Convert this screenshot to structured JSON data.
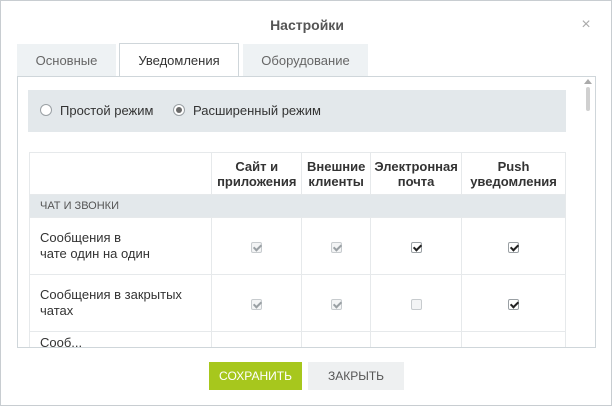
{
  "dialog": {
    "title": "Настройки",
    "close_glyph": "×"
  },
  "tabs": [
    {
      "label": "Основные",
      "active": false
    },
    {
      "label": "Уведомления",
      "active": true
    },
    {
      "label": "Оборудование",
      "active": false
    }
  ],
  "mode": {
    "simple_label": "Простой режим",
    "extended_label": "Расширенный режим",
    "selected": "extended"
  },
  "table": {
    "headers": {
      "col1": [
        "Сайт и",
        "приложения"
      ],
      "col2": [
        "Внешние",
        "клиенты"
      ],
      "col3": [
        "Электронная",
        "почта"
      ],
      "col4": [
        "Push",
        "уведомления"
      ]
    },
    "section": "ЧАТ И ЗВОНКИ",
    "rows": [
      {
        "label": [
          "Сообщения в",
          "чате один на один"
        ],
        "site": true,
        "external": true,
        "email": true,
        "push": true,
        "site_disabled": true,
        "external_disabled": true
      },
      {
        "label": [
          "Сообщения в закрытых",
          "чатах"
        ],
        "site": true,
        "external": true,
        "email": false,
        "push": true,
        "site_disabled": true,
        "external_disabled": true
      },
      {
        "label": [
          "Сооб..."
        ],
        "partial": true
      }
    ]
  },
  "buttons": {
    "save": "СОХРАНИТЬ",
    "close": "ЗАКРЫТЬ"
  },
  "colors": {
    "save_bg": "#a7c71d",
    "panel_bg": "#e3e8eb"
  }
}
